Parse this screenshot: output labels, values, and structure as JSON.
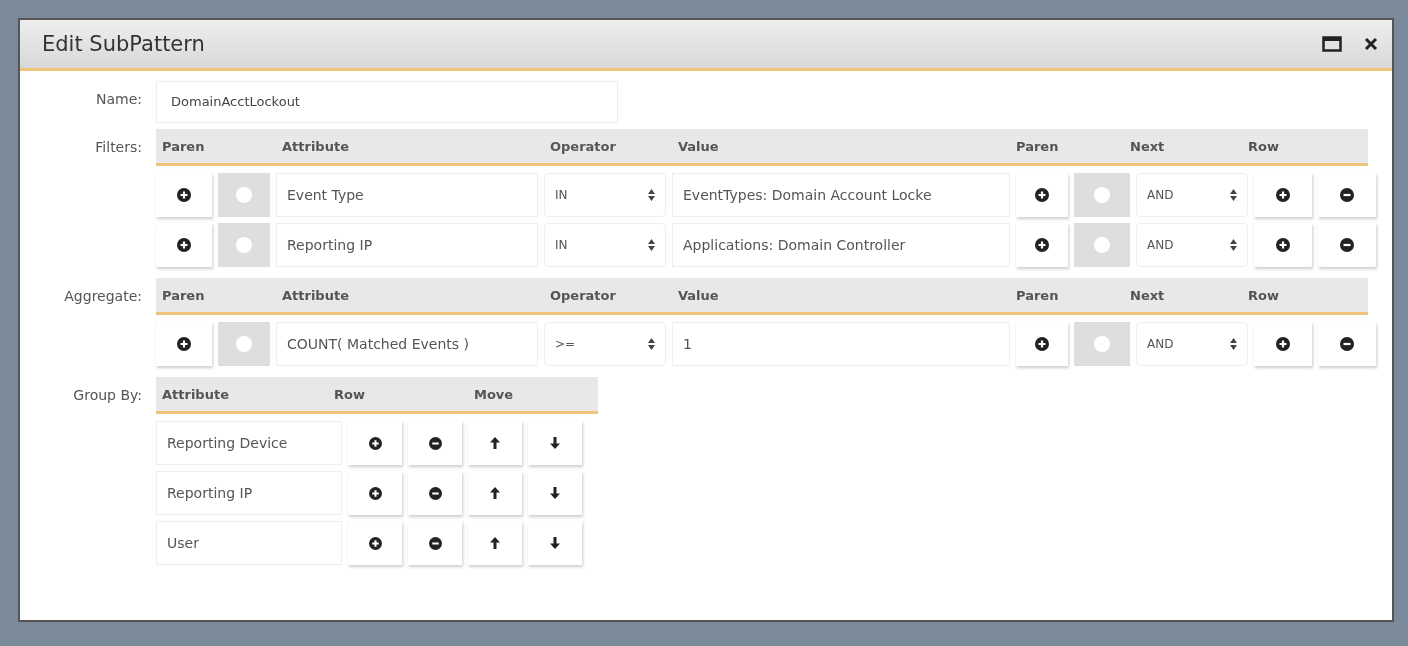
{
  "window": {
    "title": "Edit SubPattern"
  },
  "name": {
    "label": "Name:",
    "value": "DomainAcctLockout"
  },
  "filters": {
    "label": "Filters:",
    "columns": [
      "Paren",
      "Attribute",
      "Operator",
      "Value",
      "Paren",
      "Next",
      "Row"
    ],
    "rows": [
      {
        "attribute": "Event Type",
        "operator": "IN",
        "value": "EventTypes: Domain Account Locke",
        "next": "AND"
      },
      {
        "attribute": "Reporting IP",
        "operator": "IN",
        "value": "Applications: Domain Controller",
        "next": "AND"
      }
    ]
  },
  "aggregate": {
    "label": "Aggregate:",
    "columns": [
      "Paren",
      "Attribute",
      "Operator",
      "Value",
      "Paren",
      "Next",
      "Row"
    ],
    "rows": [
      {
        "attribute": "COUNT( Matched Events )",
        "operator": ">=",
        "value": "1",
        "next": "AND"
      }
    ]
  },
  "group_by": {
    "label": "Group By:",
    "columns": [
      "Attribute",
      "Row",
      "Move"
    ],
    "rows": [
      {
        "attribute": "Reporting Device"
      },
      {
        "attribute": "Reporting IP"
      },
      {
        "attribute": "User"
      }
    ]
  }
}
